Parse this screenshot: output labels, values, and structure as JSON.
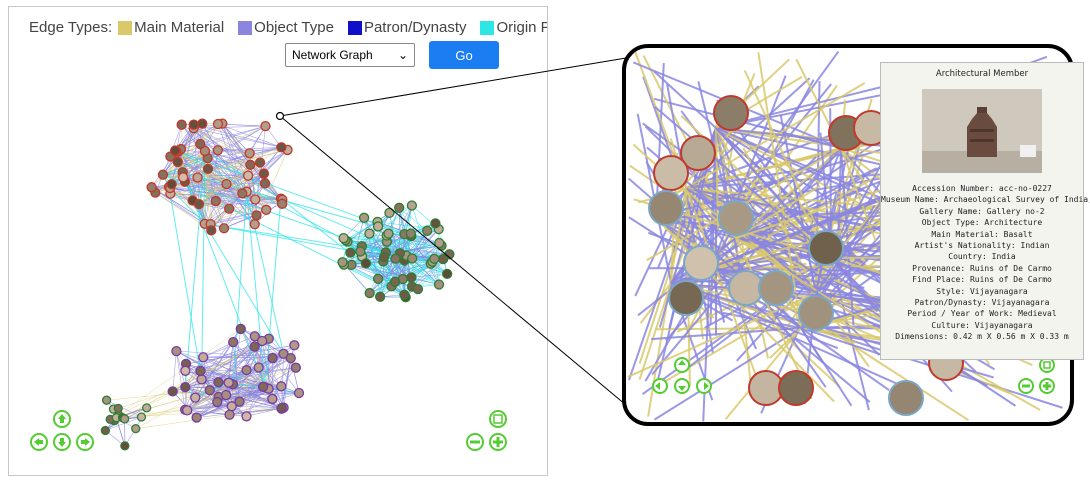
{
  "legend": {
    "label": "Edge Types:",
    "items": [
      {
        "label": "Main Material",
        "color": "#d9c96b"
      },
      {
        "label": "Object Type",
        "color": "#8a86e0"
      },
      {
        "label": "Patron/Dynasty",
        "color": "#1010c8"
      },
      {
        "label": "Origin Place",
        "color": "#2ee6e6"
      }
    ]
  },
  "controls": {
    "view_select": "Network Graph",
    "go_label": "Go"
  },
  "tooltip": {
    "title": "Architectural Member",
    "lines": [
      "Accession Number: acc-no-0227",
      "Museum Name: Archaeological Survey of India, Goa",
      "Gallery Name: Gallery no-2",
      "Object Type: Architecture",
      "Main Material: Basalt",
      "Artist's Nationality: Indian",
      "Country: India",
      "Provenance: Ruins of De Carmo",
      "Find Place: Ruins of De Carmo",
      "Style: Vijayanagara",
      "Patron/Dynasty: Vijayanagara",
      "Period / Year of Work: Medieval",
      "Culture: Vijayanagara",
      "Dimensions: 0.42 m X 0.56 m X 0.33 m"
    ]
  },
  "colors": {
    "accent": "#1a7ef2",
    "nav": "#55cc33",
    "ring_red": "#c0392b",
    "ring_purple": "#7a3aa0"
  }
}
